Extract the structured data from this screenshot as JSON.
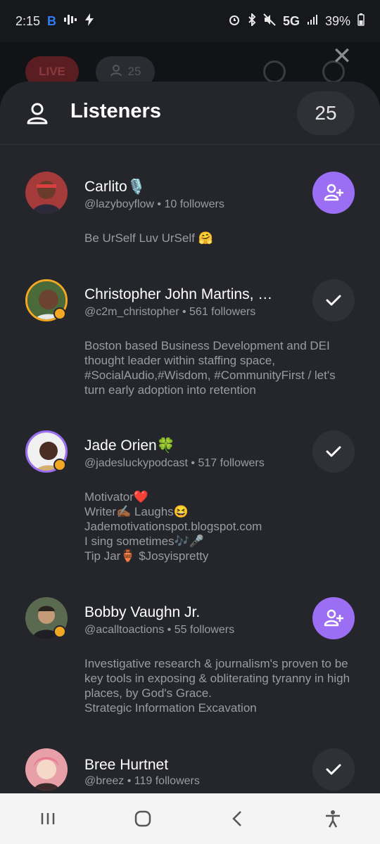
{
  "status_bar": {
    "time": "2:15",
    "left_icons": [
      "b-app-icon",
      "waveform-icon",
      "bolt-icon"
    ],
    "network": "5G",
    "battery": "39%",
    "right_icons": [
      "alarm-icon",
      "bluetooth-icon",
      "mute-icon",
      "signal-icon",
      "battery-icon"
    ]
  },
  "room": {
    "live_label": "LIVE",
    "listener_count": "25"
  },
  "sheet": {
    "title": "Listeners",
    "count": "25"
  },
  "listeners": [
    {
      "name": "Carlito🎙️",
      "handle": "@lazyboyflow",
      "followers": "10 followers",
      "bio": "Be UrSelf Luv UrSelf 🤗",
      "action": "follow",
      "verified": false
    },
    {
      "name": "Christopher John Martins, …",
      "handle": "@c2m_christopher",
      "followers": "561 followers",
      "bio": "Boston based Business Development and DEI thought leader within staffing space, #SocialAudio,#Wisdom, #CommunityFirst / let's turn early adoption into retention",
      "action": "following",
      "verified": true
    },
    {
      "name": "Jade Orien🍀",
      "handle": "@jadesluckypodcast",
      "followers": "517 followers",
      "bio": "Motivator❤️\nWriter✍🏾 Laughs😆\nJademotivationspot.blogspot.com\nI sing sometimes🎶🎤\n Tip Jar🏺  $Josyispretty",
      "action": "following",
      "verified": true
    },
    {
      "name": "Bobby Vaughn Jr.",
      "handle": "@acalltoactions",
      "followers": "55 followers",
      "bio": "Investigative research & journalism's proven to be key tools in exposing & obliterating tyranny in high places, by God's Grace.\nStrategic Information Excavation",
      "action": "follow",
      "verified": true
    },
    {
      "name": "Bree Hurtnet",
      "handle": "@breez",
      "followers": "119 followers",
      "bio": "",
      "action": "following",
      "verified": false
    }
  ],
  "separator": " • ",
  "nav": [
    "recent-apps-icon",
    "home-icon",
    "back-icon",
    "accessibility-icon"
  ],
  "colors": {
    "accent": "#9b6ef3",
    "sheet_bg": "#24262c",
    "live": "#5a1d22",
    "badge": "#f2a823"
  }
}
